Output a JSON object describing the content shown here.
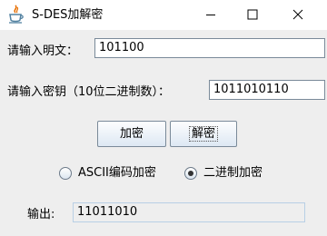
{
  "window": {
    "title": "S-DES加解密"
  },
  "form": {
    "plaintext_label": "请输入明文：",
    "plaintext_value": "101100",
    "key_label": "请输入密钥（10位二进制数）：",
    "key_value": "1011010110",
    "encrypt_button": "加密",
    "decrypt_button": "解密",
    "radio_ascii_label": "ASCII编码加密",
    "radio_binary_label": "二进制加密",
    "selected_mode": "二进制加密",
    "output_label": "输出:",
    "output_value": "11011010"
  }
}
